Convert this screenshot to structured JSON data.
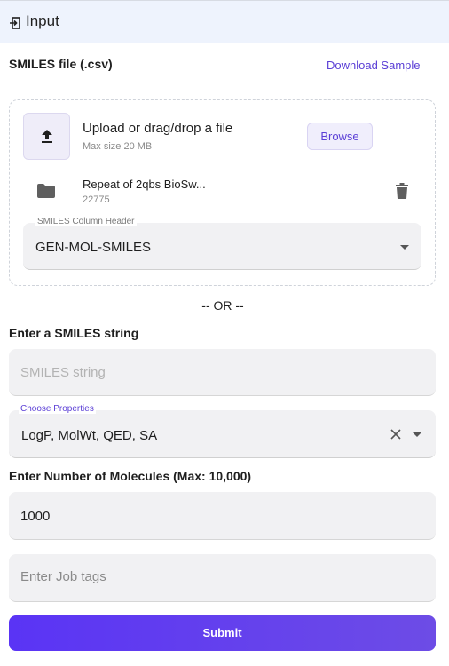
{
  "header": {
    "title": "Input",
    "icon": "login-icon"
  },
  "smiles_file": {
    "label": "SMILES file (.csv)",
    "download_sample": "Download Sample",
    "upload_title": "Upload or drag/drop a file",
    "max_size": "Max size 20 MB",
    "browse_label": "Browse",
    "file": {
      "name": "Repeat of 2qbs BioSw...",
      "size": "22775"
    },
    "column_header": {
      "label": "SMILES Column Header",
      "value": "GEN-MOL-SMILES"
    }
  },
  "or_separator": "-- OR --",
  "smiles_string": {
    "label": "Enter a SMILES string",
    "placeholder": "SMILES string"
  },
  "properties": {
    "label": "Choose Properties",
    "value": "LogP, MolWt, QED, SA"
  },
  "molecules": {
    "label": "Enter Number of Molecules (Max: 10,000)",
    "value": "1000"
  },
  "job_tags": {
    "placeholder": "Enter Job tags"
  },
  "submit_label": "Submit",
  "colors": {
    "accent": "#5b3fd6",
    "header_bg": "#eef3fd",
    "field_bg": "#f1f1f3",
    "submit_start": "#5a34f5",
    "submit_end": "#6d4ce6"
  }
}
